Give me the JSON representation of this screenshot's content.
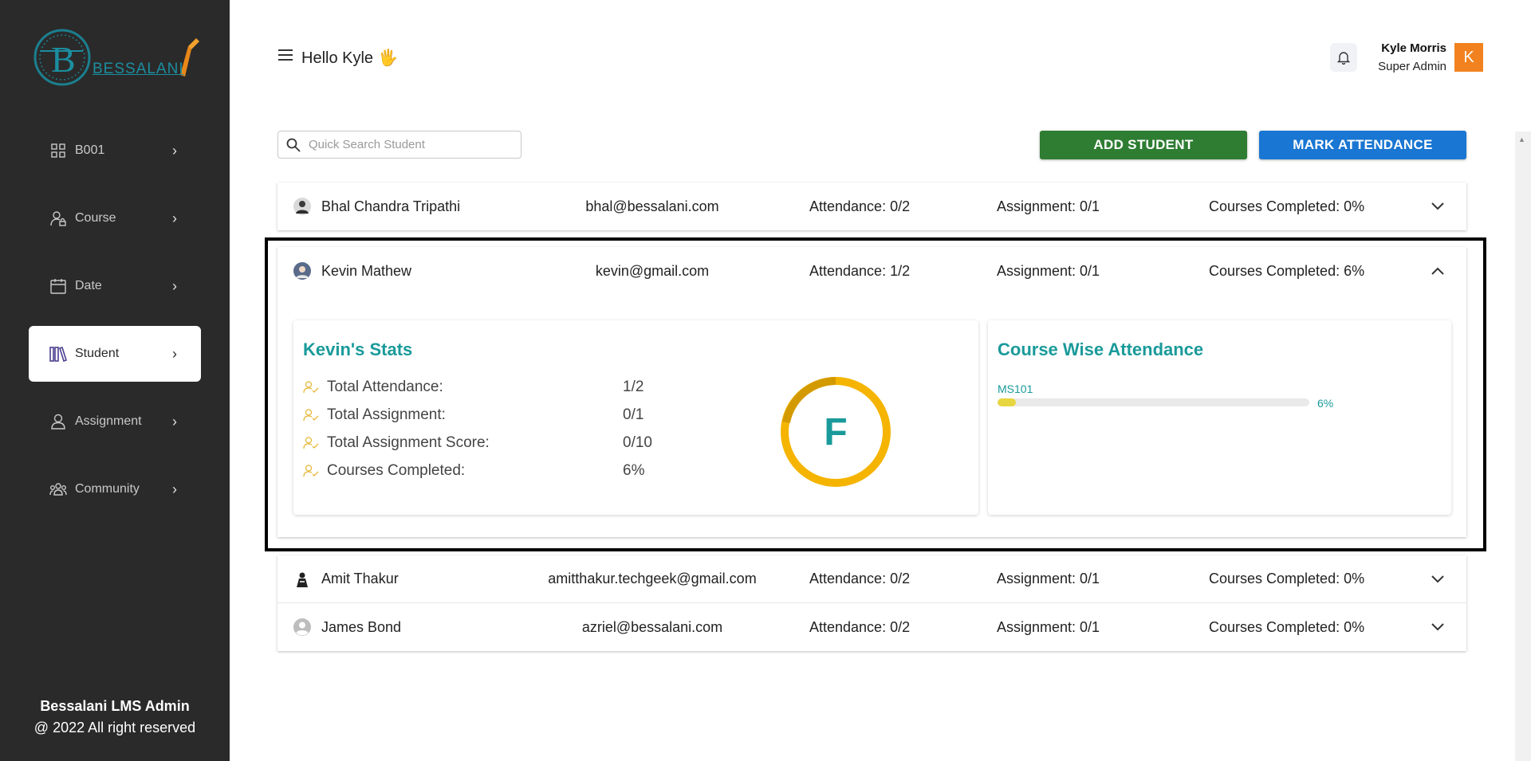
{
  "sidebar": {
    "logo_text": "BESSALANI",
    "items": [
      {
        "label": "B001",
        "icon": "grid-icon"
      },
      {
        "label": "Course",
        "icon": "user-lock-icon"
      },
      {
        "label": "Date",
        "icon": "calendar-icon"
      },
      {
        "label": "Student",
        "icon": "books-icon"
      },
      {
        "label": "Assignment",
        "icon": "person-icon"
      },
      {
        "label": "Community",
        "icon": "group-icon"
      }
    ],
    "active_index": 3,
    "footer_title": "Bessalani LMS Admin",
    "footer_copy": "@ 2022 All right reserved"
  },
  "header": {
    "greeting": "Hello Kyle",
    "wave": "🖐",
    "user_name": "Kyle Morris",
    "user_role": "Super Admin",
    "avatar_initial": "K"
  },
  "toolbar": {
    "search_placeholder": "Quick Search Student",
    "add_label": "ADD STUDENT",
    "mark_label": "MARK ATTENDANCE"
  },
  "students": [
    {
      "name": "Bhal Chandra Tripathi",
      "email": "bhal@bessalani.com",
      "attendance": "Attendance: 0/2",
      "assignment": "Assignment: 0/1",
      "completed": "Courses Completed: 0%"
    },
    {
      "name": "Kevin Mathew",
      "email": "kevin@gmail.com",
      "attendance": "Attendance: 1/2",
      "assignment": "Assignment: 0/1",
      "completed": "Courses Completed: 6%"
    },
    {
      "name": "Amit Thakur",
      "email": "amitthakur.techgeek@gmail.com",
      "attendance": "Attendance: 0/2",
      "assignment": "Assignment: 0/1",
      "completed": "Courses Completed: 0%"
    },
    {
      "name": "James Bond",
      "email": "azriel@bessalani.com",
      "attendance": "Attendance: 0/2",
      "assignment": "Assignment: 0/1",
      "completed": "Courses Completed: 0%"
    }
  ],
  "stats": {
    "title": "Kevin's Stats",
    "lines": [
      {
        "label": "Total Attendance:",
        "value": "1/2"
      },
      {
        "label": "Total Assignment:",
        "value": "0/1"
      },
      {
        "label": "Total Assignment Score:",
        "value": "0/10"
      },
      {
        "label": "Courses Completed:",
        "value": "6%"
      }
    ],
    "grade": "F"
  },
  "course_attendance": {
    "title": "Course Wise Attendance",
    "courses": [
      {
        "code": "MS101",
        "percent_label": "6%",
        "percent": 6
      }
    ]
  },
  "colors": {
    "sidebar_bg": "#2b2a2a",
    "accent_teal": "#1a9a9a",
    "add_green": "#2e7d32",
    "mark_blue": "#1976d2",
    "avatar_orange": "#f2821f",
    "grade_ring": "#f5b400"
  }
}
